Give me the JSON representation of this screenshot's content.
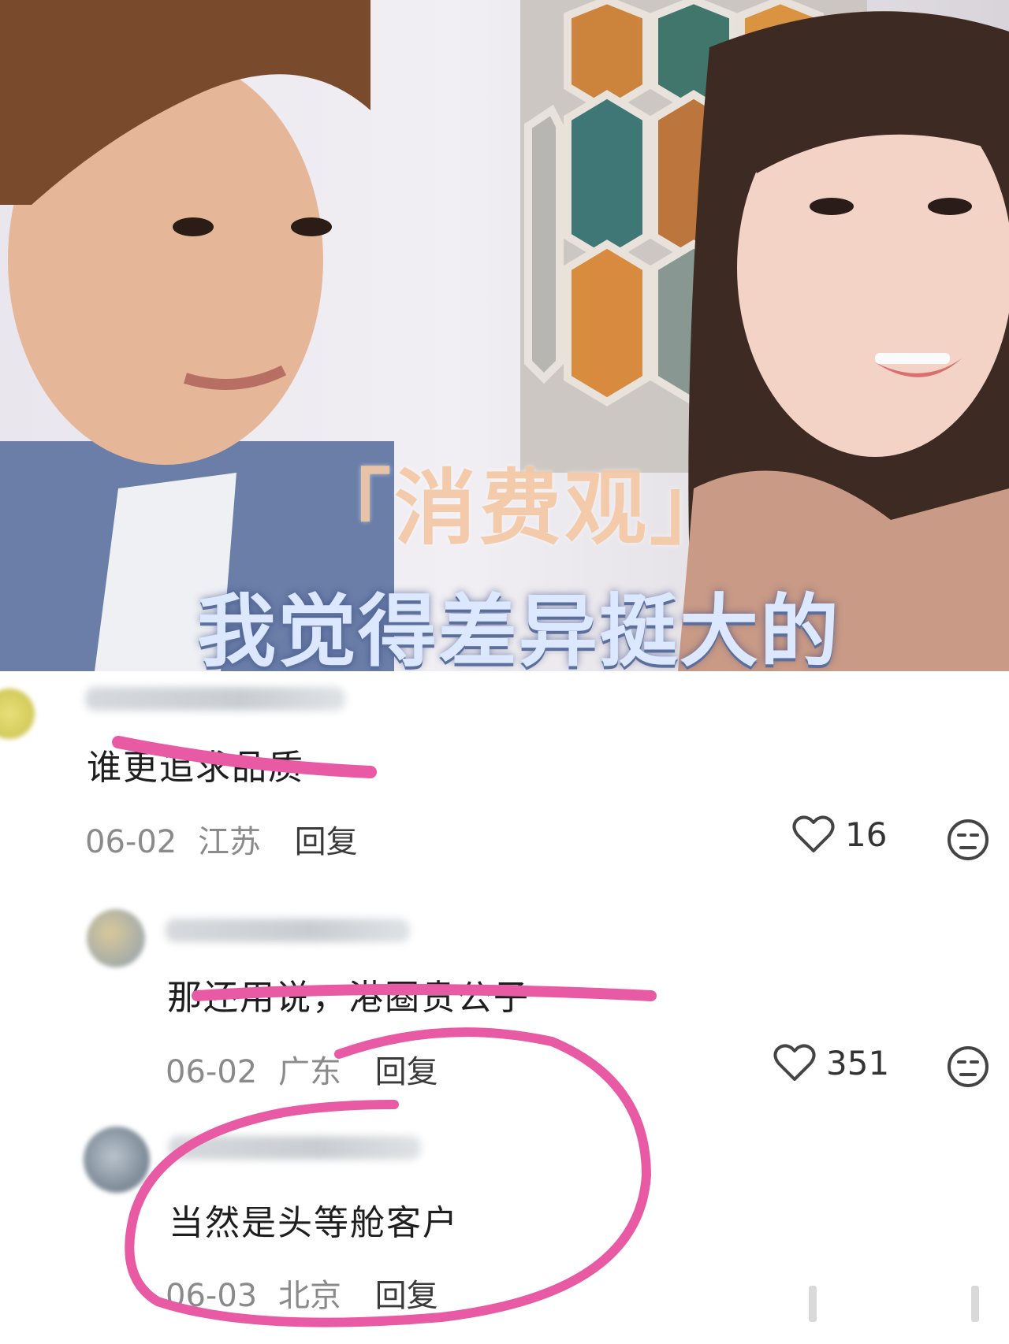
{
  "video": {
    "caption_line1": "「消费观」",
    "caption_line2": "我觉得差异挺大的"
  },
  "comments": [
    {
      "text": "谁更追求品质",
      "date": "06-02",
      "location": "江苏",
      "reply_label": "回复",
      "likes": "16",
      "like_icon": "heart-outline-icon",
      "dislike_icon": "unamused-face-icon"
    },
    {
      "text": "那还用说，港圈贵公子",
      "date": "06-02",
      "location": "广东",
      "reply_label": "回复",
      "likes": "351",
      "like_icon": "heart-outline-icon",
      "dislike_icon": "unamused-face-icon"
    },
    {
      "text": "当然是头等舱客户",
      "date": "06-03",
      "location": "北京",
      "reply_label": "回复"
    }
  ],
  "colors": {
    "annotation_pink": "#e85aa4",
    "meta_gray": "#8a8a8a",
    "text_dark": "#1e1e1e"
  }
}
